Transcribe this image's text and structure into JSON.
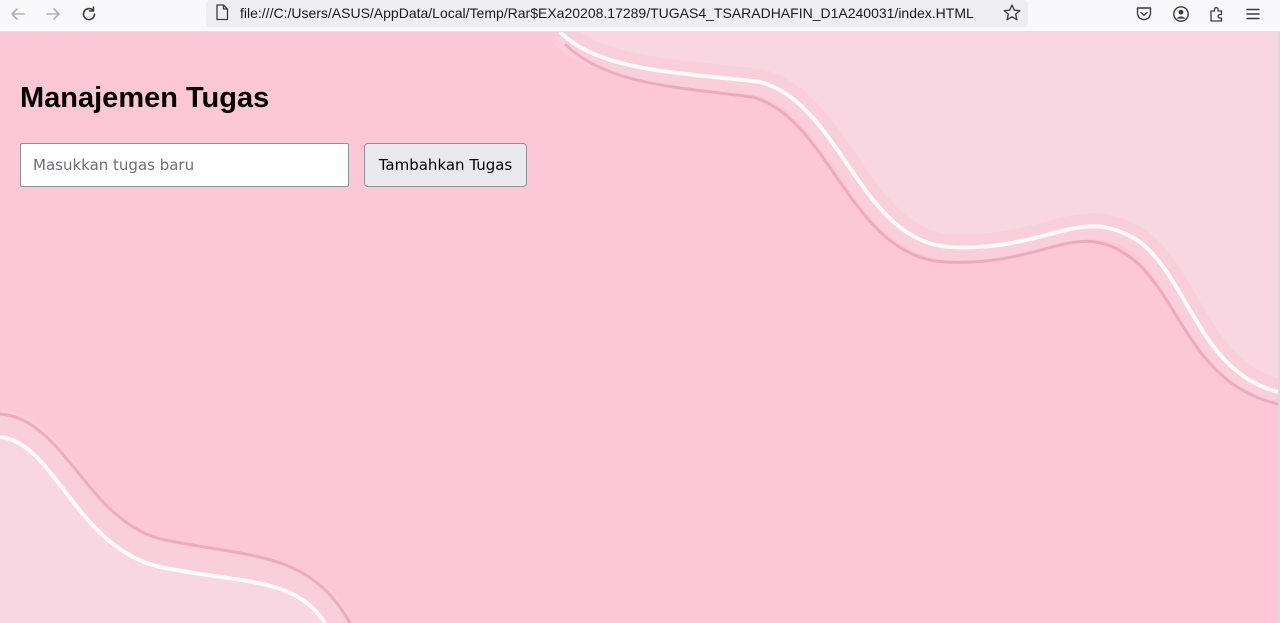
{
  "browser": {
    "url": "file:///C:/Users/ASUS/AppData/Local/Temp/Rar$EXa20208.17289/TUGAS4_TSARADHAFIN_D1A240031/index.HTML",
    "icons": [
      "back-icon",
      "forward-icon",
      "reload-icon",
      "page-icon",
      "bookmark-star-icon",
      "pocket-icon",
      "account-icon",
      "extensions-icon",
      "menu-icon"
    ]
  },
  "page": {
    "title": "Manajemen Tugas",
    "task_input": {
      "placeholder": "Masukkan tugas baru",
      "value": ""
    },
    "add_button_label": "Tambahkan Tugas",
    "colors": {
      "background": "#fcc8d8",
      "wave_light": "#f8d6e2",
      "wave_stroke": "#e8a3b8"
    }
  }
}
